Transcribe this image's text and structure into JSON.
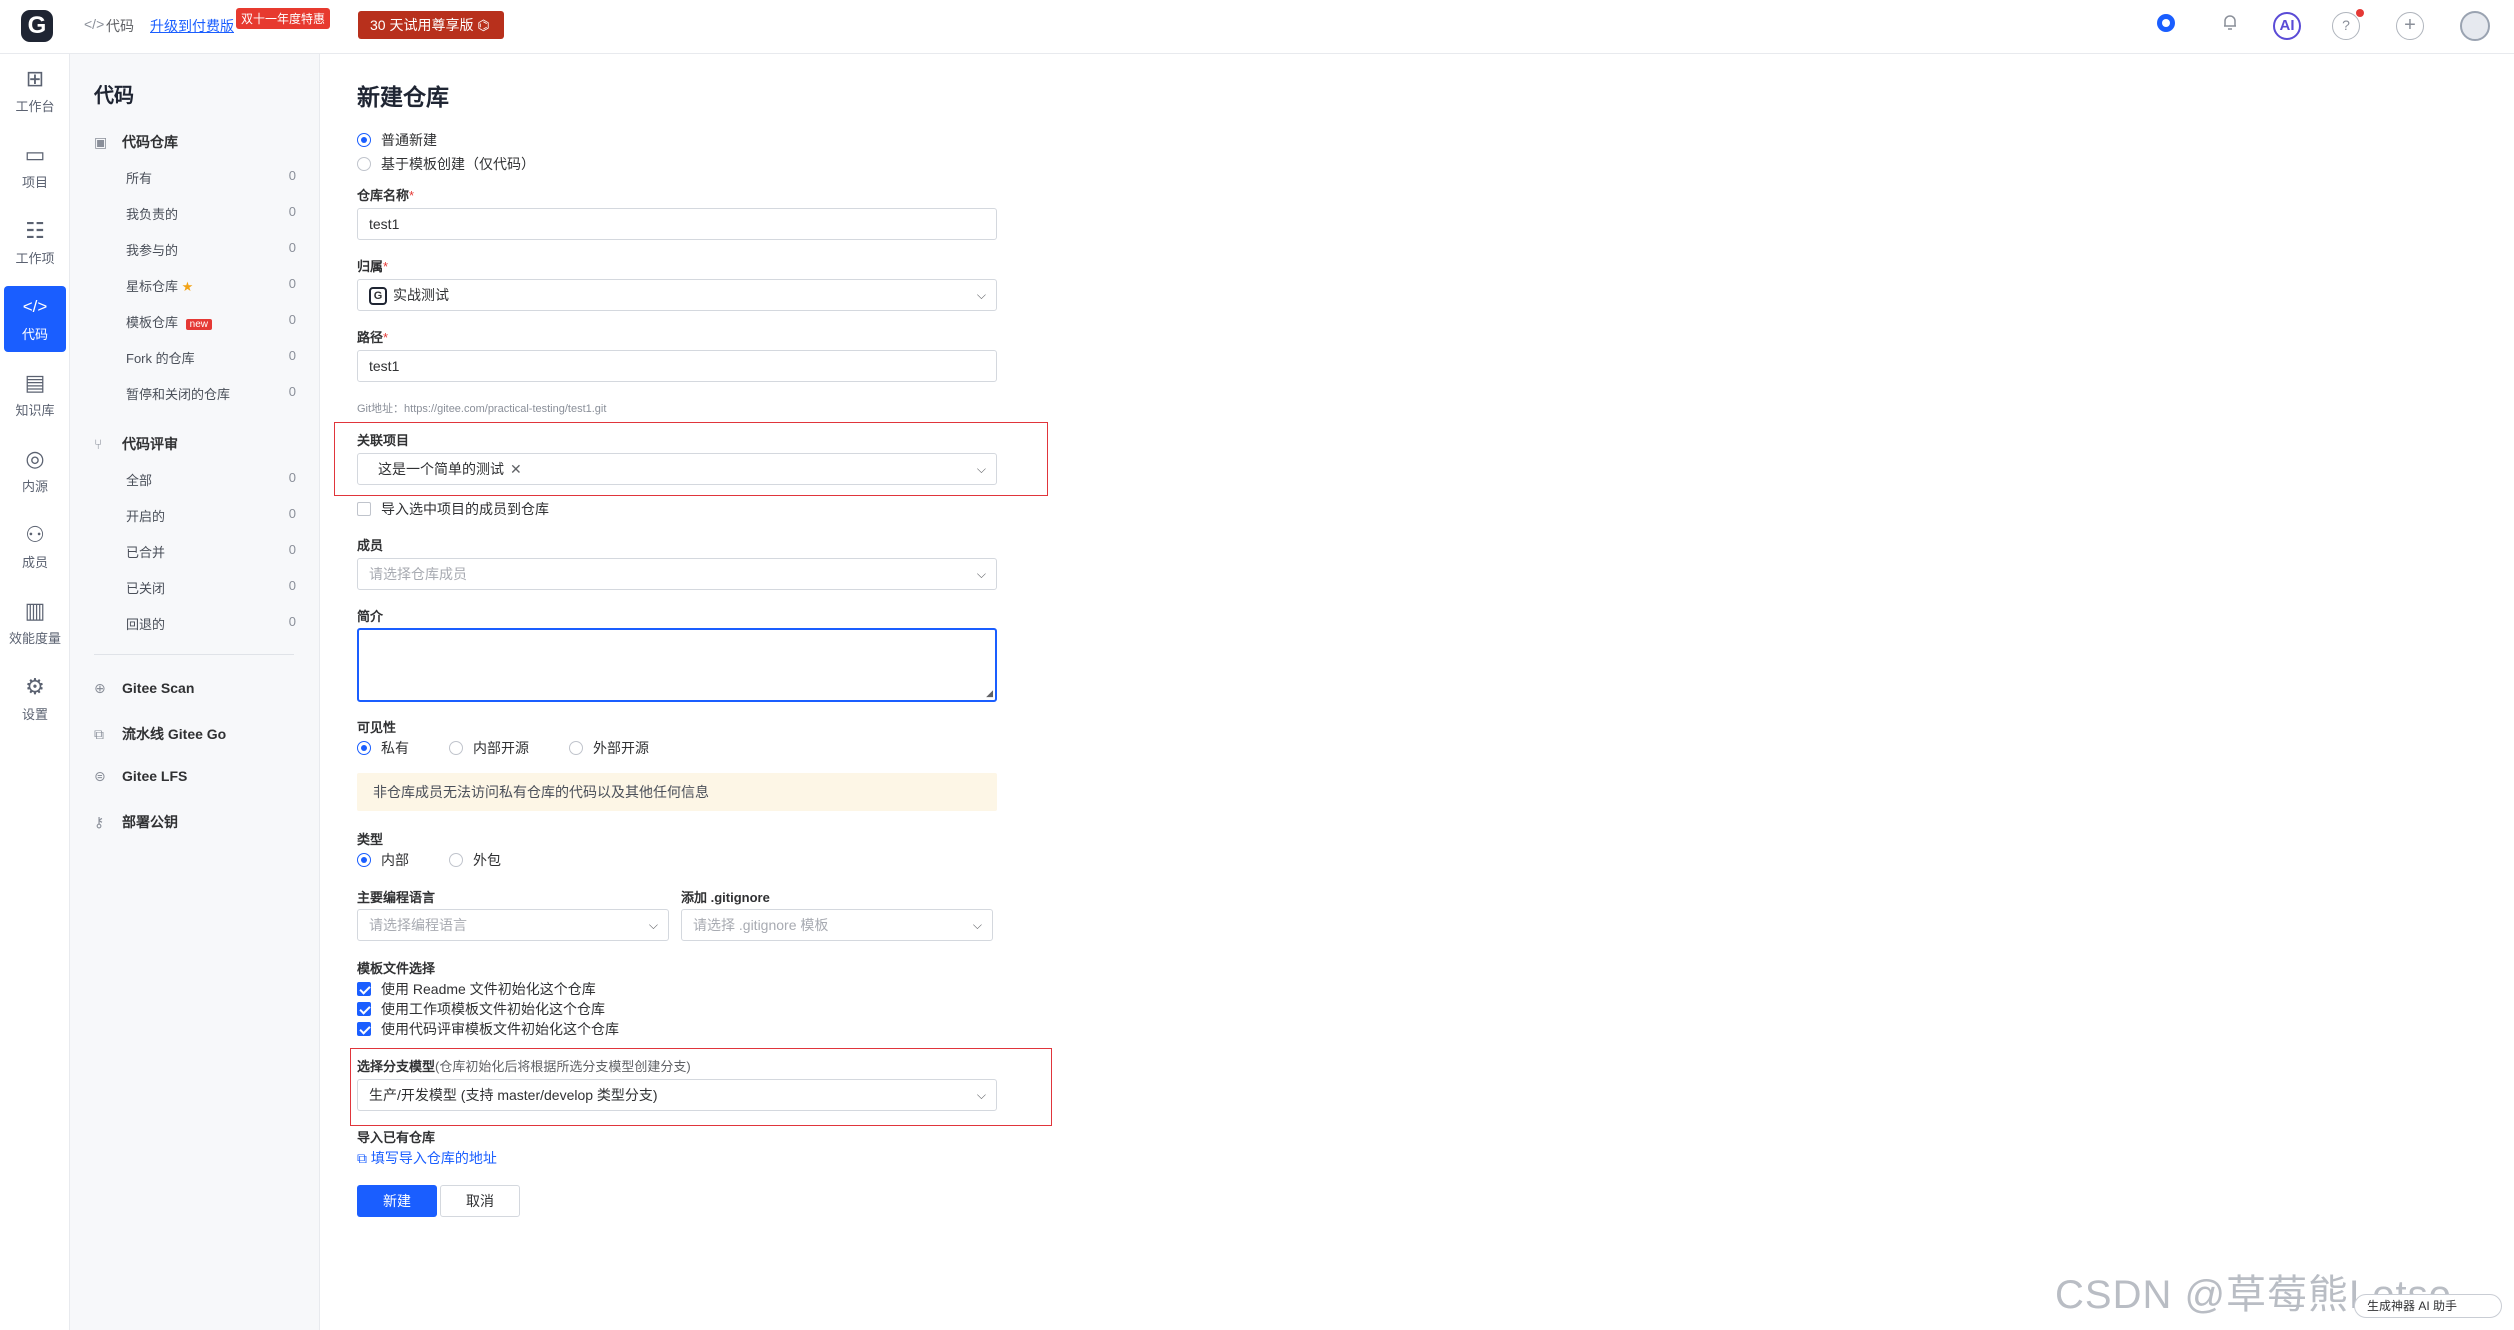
{
  "topbar": {
    "crumb_icon": "</>",
    "crumb_code": "代码",
    "upgrade_link": "升级到付费版",
    "promo_badge": "双十一年度特惠",
    "trial_button": "30 天试用尊享版 ⌬",
    "ai_label": "AI",
    "help_glyph": "?",
    "add_glyph": "+"
  },
  "rail": {
    "items": [
      {
        "icon": "dashboard-icon",
        "glyph": "⊞",
        "label": "工作台"
      },
      {
        "icon": "project-icon",
        "glyph": "▭",
        "label": "项目"
      },
      {
        "icon": "workitem-icon",
        "glyph": "☷",
        "label": "工作项"
      },
      {
        "icon": "code-icon",
        "glyph": "</>",
        "label": "代码"
      },
      {
        "icon": "wiki-icon",
        "glyph": "▤",
        "label": "知识库"
      },
      {
        "icon": "innersource-icon",
        "glyph": "◎",
        "label": "内源"
      },
      {
        "icon": "members-icon",
        "glyph": "⚇",
        "label": "成员"
      },
      {
        "icon": "metrics-icon",
        "glyph": "▥",
        "label": "效能度量"
      },
      {
        "icon": "settings-icon",
        "glyph": "⚙",
        "label": "设置"
      }
    ]
  },
  "sidebar": {
    "title": "代码",
    "repo_group": "代码仓库",
    "repo_items": [
      {
        "label": "所有",
        "count": "0"
      },
      {
        "label": "我负责的",
        "count": "0"
      },
      {
        "label": "我参与的",
        "count": "0"
      },
      {
        "label": "星标仓库",
        "count": "0"
      },
      {
        "label": "模板仓库",
        "count": "0"
      },
      {
        "label": "Fork 的仓库",
        "count": "0"
      },
      {
        "label": "暂停和关闭的仓库",
        "count": "0"
      }
    ],
    "new_badge": "new",
    "review_group": "代码评审",
    "review_items": [
      {
        "label": "全部",
        "count": "0"
      },
      {
        "label": "开启的",
        "count": "0"
      },
      {
        "label": "已合并",
        "count": "0"
      },
      {
        "label": "已关闭",
        "count": "0"
      },
      {
        "label": "回退的",
        "count": "0"
      }
    ],
    "links": [
      "Gitee Scan",
      "流水线 Gitee Go",
      "Gitee LFS",
      "部署公钥"
    ]
  },
  "form": {
    "title": "新建仓库",
    "create_options": [
      "普通新建",
      "基于模板创建（仅代码）"
    ],
    "repo_name_label": "仓库名称",
    "repo_name_value": "test1",
    "owner_label": "归属",
    "owner_value": "实战测试",
    "path_label": "路径",
    "path_value": "test1",
    "git_url": "Git地址：https://gitee.com/practical-testing/test1.git",
    "project_label": "关联项目",
    "project_value": "这是一个简单的测试",
    "import_members": "导入选中项目的成员到仓库",
    "members_label": "成员",
    "members_placeholder": "请选择仓库成员",
    "intro_label": "简介",
    "intro_value": "",
    "visibility_label": "可见性",
    "visibility_options": [
      "私有",
      "内部开源",
      "外部开源"
    ],
    "visibility_warning": "非仓库成员无法访问私有仓库的代码以及其他任何信息",
    "type_label": "类型",
    "type_options": [
      "内部",
      "外包"
    ],
    "language_label": "主要编程语言",
    "language_placeholder": "请选择编程语言",
    "gitignore_label": "添加 .gitignore",
    "gitignore_placeholder": "请选择 .gitignore 模板",
    "template_label": "模板文件选择",
    "template_options": [
      "使用 Readme 文件初始化这个仓库",
      "使用工作项模板文件初始化这个仓库",
      "使用代码评审模板文件初始化这个仓库"
    ],
    "branch_label": "选择分支模型",
    "branch_sub": "(仓库初始化后将根据所选分支模型创建分支)",
    "branch_value": "生产/开发模型 (支持 master/develop 类型分支)",
    "import_label": "导入已有仓库",
    "import_link": "填写导入仓库的地址",
    "submit": "新建",
    "cancel": "取消"
  },
  "overlay": {
    "csdn_watermark": "CSDN @草莓熊Lotso",
    "ai_helper": "生成神器 AI 助手"
  },
  "colors": {
    "accent": "#1a5eff",
    "highlight_box": "#e0353b",
    "warning_bg": "#fdf6e6",
    "promo": "#b8301c"
  }
}
